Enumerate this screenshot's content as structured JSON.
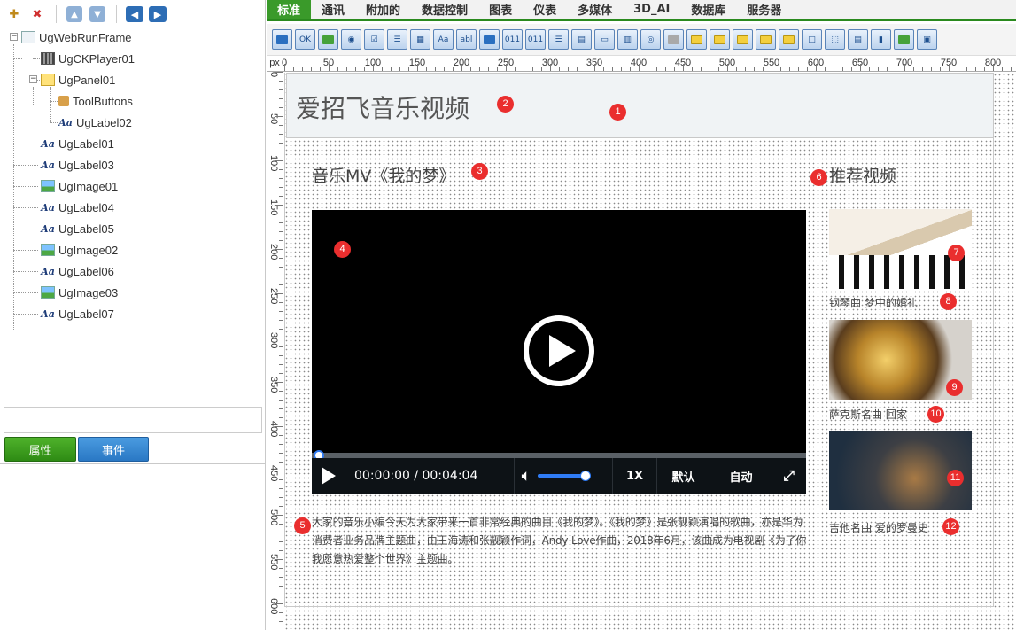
{
  "left_panel": {
    "tree": [
      {
        "label": "UgWebRunFrame",
        "icon": "frame-icon"
      },
      {
        "label": "UgCKPlayer01",
        "icon": "player-icon"
      },
      {
        "label": "UgPanel01",
        "icon": "panel-icon"
      },
      {
        "label": "ToolButtons",
        "icon": "bag-icon"
      },
      {
        "label": "UgLabel02",
        "icon": "label-icon"
      },
      {
        "label": "UgLabel01",
        "icon": "label-icon"
      },
      {
        "label": "UgLabel03",
        "icon": "label-icon"
      },
      {
        "label": "UgImage01",
        "icon": "image-icon"
      },
      {
        "label": "UgLabel04",
        "icon": "label-icon"
      },
      {
        "label": "UgLabel05",
        "icon": "label-icon"
      },
      {
        "label": "UgImage02",
        "icon": "image-icon"
      },
      {
        "label": "UgLabel06",
        "icon": "label-icon"
      },
      {
        "label": "UgImage03",
        "icon": "image-icon"
      },
      {
        "label": "UgLabel07",
        "icon": "label-icon"
      }
    ],
    "properties_button": "属性",
    "events_button": "事件"
  },
  "tabs": [
    "标准",
    "通讯",
    "附加的",
    "数据控制",
    "图表",
    "仪表",
    "多媒体",
    "3D_AI",
    "数据库",
    "服务器"
  ],
  "active_tab": "标准",
  "ruler": {
    "unit": "px",
    "h_labels": [
      "0",
      "50",
      "100",
      "150",
      "200",
      "250",
      "300",
      "350",
      "400",
      "450",
      "500",
      "550",
      "600",
      "650",
      "700",
      "750",
      "800"
    ],
    "v_labels": [
      "0",
      "50",
      "100",
      "150",
      "200",
      "250",
      "300",
      "350",
      "400",
      "450",
      "500",
      "550",
      "600"
    ]
  },
  "design": {
    "site_title": "爱招飞音乐视频",
    "video_heading": "音乐MV《我的梦》",
    "recommend_heading": "推荐视频",
    "player": {
      "time": "00:00:00 / 00:04:04",
      "rate": "1X",
      "definition": "默认",
      "auto": "自动",
      "progress": 0.0,
      "volume": 0.75
    },
    "description": "大家的音乐小编今天为大家带来一首非常经典的曲目《我的梦》。《我的梦》是张靓颖演唱的歌曲，亦是华为消费者业务品牌主题曲，由王海涛和张靓颖作词，Andy Love作曲，2018年6月，该曲成为电视剧《为了你我愿意热爱整个世界》主题曲。",
    "captions": [
      "钢琴曲 梦中的婚礼",
      "萨克斯名曲 回家",
      "吉他名曲 爱的罗曼史"
    ],
    "badges": [
      "1",
      "2",
      "3",
      "4",
      "5",
      "6",
      "7",
      "8",
      "9",
      "10",
      "11",
      "12"
    ]
  },
  "colors": {
    "tab_active": "#3a9a2a",
    "badge": "#ea2e2e",
    "player_accent": "#2f7cf6"
  }
}
